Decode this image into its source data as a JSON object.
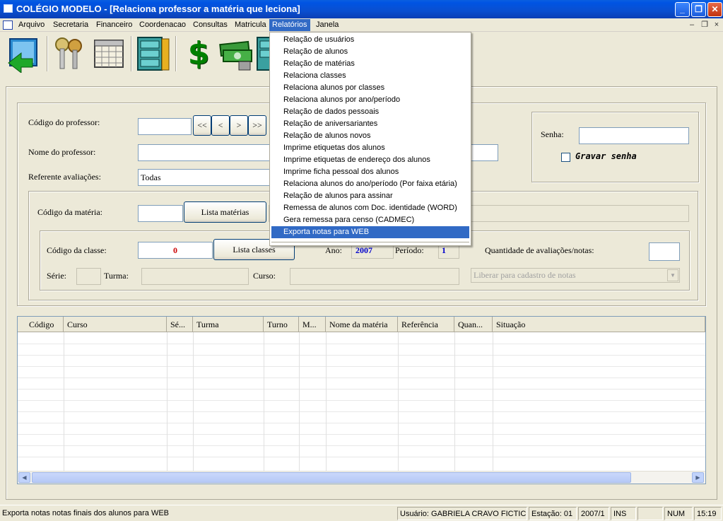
{
  "window": {
    "title": "COLÉGIO MODELO - [Relaciona professor a matéria que leciona]",
    "minimize": "_",
    "maximize": "❐",
    "close": "✕"
  },
  "menubar": {
    "items": [
      "Arquivo",
      "Secretaria",
      "Financeiro",
      "Coordenacao",
      "Consultas",
      "Matricula",
      "Relatórios",
      "Janela"
    ],
    "active": "Relatórios",
    "mdi_min": "–",
    "mdi_restore": "❐",
    "mdi_close": "×"
  },
  "toolbar": {
    "icons": [
      "exit-door-icon",
      "keys-icon",
      "calendar-icon",
      "filing-cabinet-icon",
      "dollar-icon",
      "money-bills-icon",
      "cabinet-icon"
    ],
    "dollar_glyph": "$"
  },
  "dropdown": {
    "items": [
      "Relação de usuários",
      "Relação de alunos",
      "Relação de matérias",
      "Relaciona classes",
      "Relaciona alunos por classes",
      "Relaciona alunos por ano/período",
      "Relação de dados pessoais",
      "Relação de aniversariantes",
      "Relação de alunos novos",
      "Imprime etiquetas dos alunos",
      "Imprime etiquetas de endereço dos alunos",
      "Imprime ficha pessoal dos alunos",
      "Relaciona alunos do ano/período (Por faixa etária)",
      "Relação de alunos para assinar",
      "Remessa de alunos com Doc. identidade (WORD)",
      "Gera remessa para censo (CADMEC)",
      "Exporta notas para WEB"
    ],
    "highlighted": "Exporta notas para WEB"
  },
  "form": {
    "codigo_professor_label": "Código do professor:",
    "codigo_professor_value": "",
    "nav_first": "<<",
    "nav_prev": "<",
    "nav_next": ">",
    "nav_last": ">>",
    "nome_professor_label": "Nome do professor:",
    "nome_professor_value": "",
    "referente_label": "Referente avaliações:",
    "referente_value": "Todas",
    "senha_label": "Senha:",
    "senha_value": "",
    "gravar_senha_label": "Gravar senha",
    "gravar_senha_checked": false,
    "codigo_materia_label": "Código da matéria:",
    "codigo_materia_value": "",
    "lista_materias_button": "Lista matérias",
    "codigo_classe_label": "Código da classe:",
    "codigo_classe_value": "0",
    "lista_classes_button": "Lista classes",
    "ano_label": "Ano:",
    "ano_value": "2007",
    "periodo_label": "Período:",
    "periodo_value": "1",
    "quantidade_label": "Quantidade de avaliações/notas:",
    "quantidade_value": "",
    "serie_label": "Série:",
    "serie_value": "",
    "turma_label": "Turma:",
    "turma_value": "",
    "curso_label": "Curso:",
    "curso_value": "",
    "liberar_select": "Liberar para cadastro de notas"
  },
  "grid": {
    "columns": [
      "Código",
      "Curso",
      "Sé...",
      "Turma",
      "Turno",
      "M...",
      "Nome da matéria",
      "Referência",
      "Quan...",
      "Situação"
    ],
    "rows": []
  },
  "statusbar": {
    "message": "Exporta notas notas finais dos alunos para WEB",
    "usuario": "Usuário: GABRIELA CRAVO FICTICIO",
    "estacao": "Estação: 01",
    "periodo": "2007/1",
    "ins": "INS",
    "blank": "",
    "num": "NUM",
    "time": "15:19"
  },
  "colors": {
    "titlebar": "#0054e3",
    "menu_highlight": "#316ac5",
    "classe_value": "#cc0000",
    "ano_value": "#0000cc",
    "dollar": "#008000"
  }
}
